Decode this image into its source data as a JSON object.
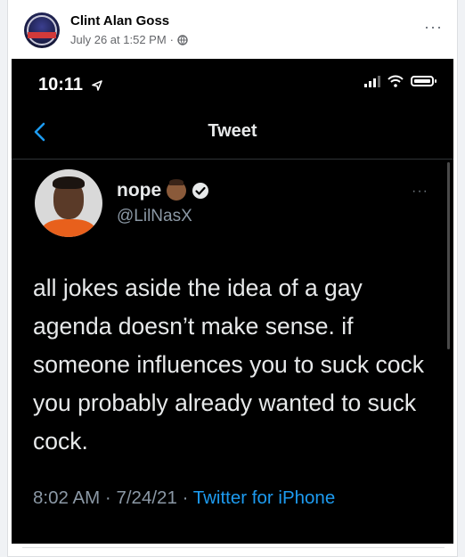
{
  "post": {
    "author_name": "Clint Alan Goss",
    "timestamp": "July 26 at 1:52 PM",
    "separator": "·",
    "more_label": "···"
  },
  "phone": {
    "time": "10:11"
  },
  "tweet_nav": {
    "title": "Tweet"
  },
  "tweet": {
    "display_name": "nope",
    "handle": "@LilNasX",
    "more_label": "···",
    "text": "all jokes aside the idea of a gay agenda doesn’t make sense. if someone influences you to suck cock you probably already wanted to suck cock.",
    "time": "8:02 AM",
    "date": "7/24/21",
    "sep": "·",
    "source": "Twitter for iPhone"
  },
  "icons": {
    "globe": "globe-icon",
    "back": "chevron-left-icon",
    "verified": "verified-badge-icon",
    "emoji": "baby-emoji-icon",
    "location": "location-arrow-icon",
    "signal": "signal-icon",
    "wifi": "wifi-icon",
    "battery": "battery-icon"
  },
  "colors": {
    "fb_name": "#050505",
    "fb_meta": "#65676b",
    "tweet_bg": "#000000",
    "tweet_text": "#e7e9ea",
    "tweet_muted": "#8b98a5",
    "twitter_blue": "#1d9bf0"
  }
}
